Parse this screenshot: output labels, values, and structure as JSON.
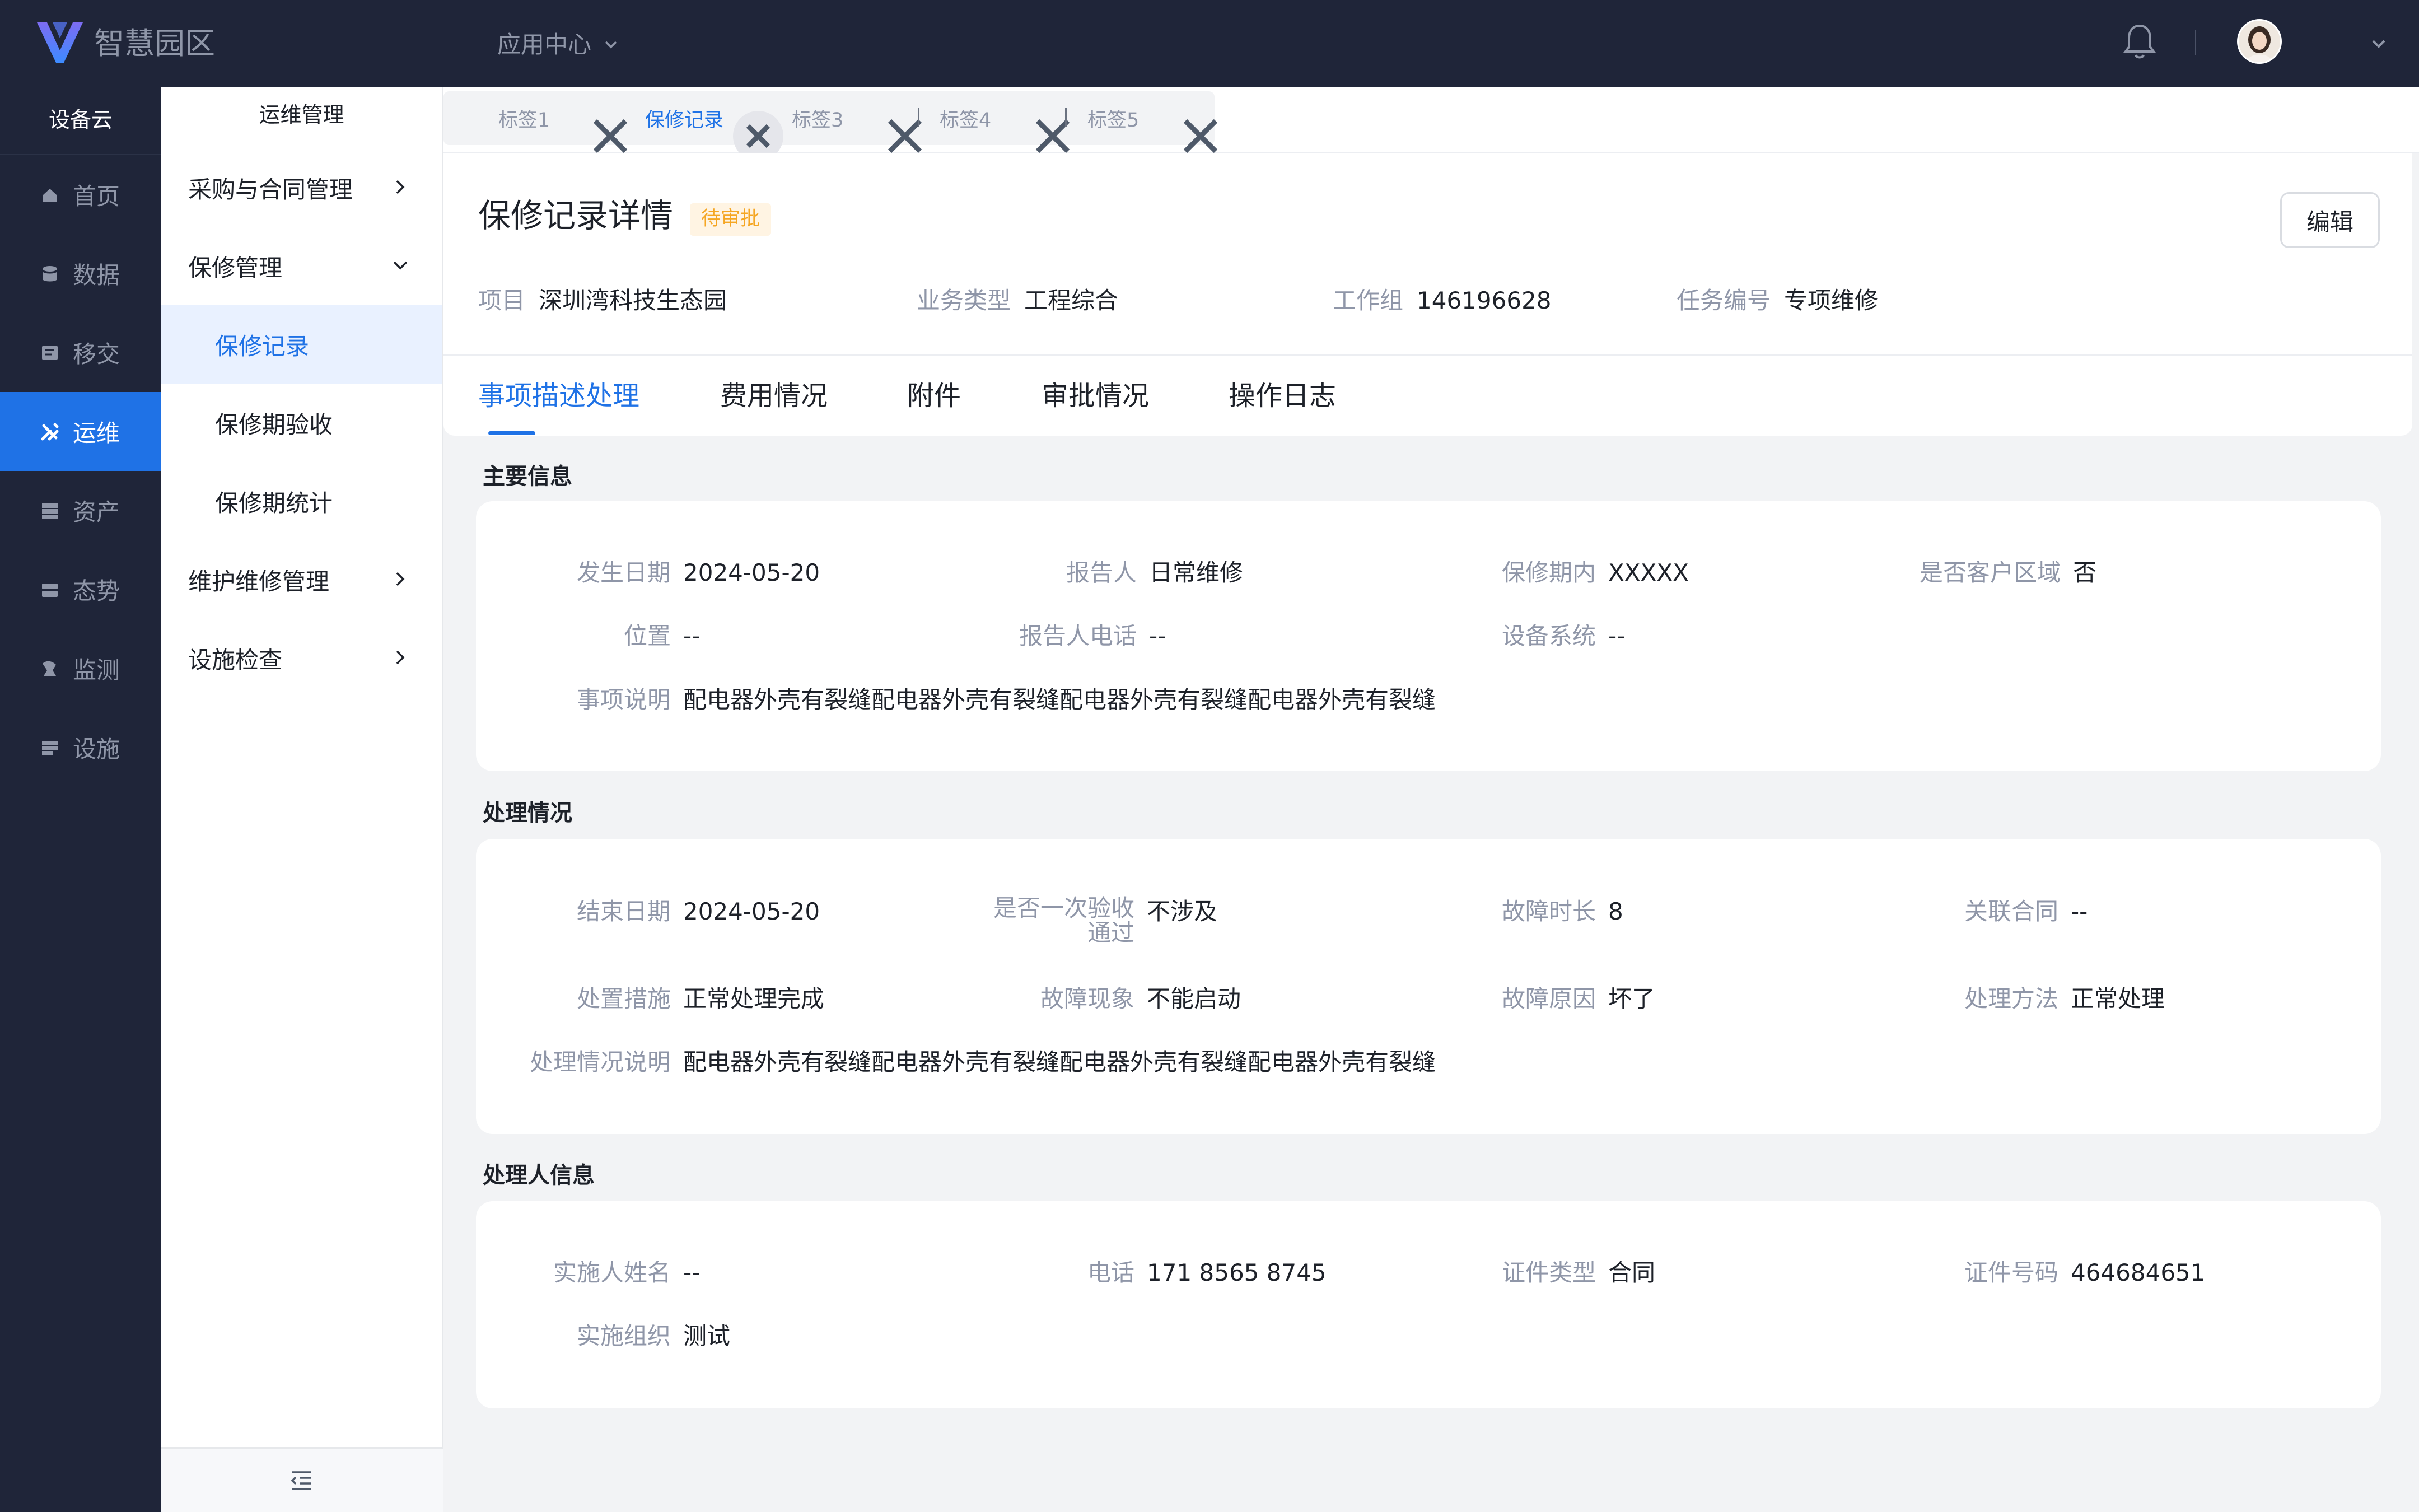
{
  "app": {
    "brand": "智慧园区",
    "app_center": "应用中心"
  },
  "nav": {
    "header": "设备云",
    "items": [
      {
        "label": "首页",
        "icon": "home-icon",
        "active": false
      },
      {
        "label": "数据",
        "icon": "data-icon",
        "active": false
      },
      {
        "label": "移交",
        "icon": "transfer-icon",
        "active": false
      },
      {
        "label": "运维",
        "icon": "tools-icon",
        "active": true
      },
      {
        "label": "资产",
        "icon": "asset-icon",
        "active": false
      },
      {
        "label": "态势",
        "icon": "situation-icon",
        "active": false
      },
      {
        "label": "监测",
        "icon": "monitor-icon",
        "active": false
      },
      {
        "label": "设施",
        "icon": "facility-icon",
        "active": false
      }
    ]
  },
  "submenu": {
    "header": "运维管理",
    "items": [
      {
        "label": "采购与合同管理"
      },
      {
        "label": "保修管理"
      },
      {
        "label": "保修记录"
      },
      {
        "label": "保修期验收"
      },
      {
        "label": "保修期统计"
      },
      {
        "label": "维护维修管理"
      },
      {
        "label": "设施检查"
      }
    ]
  },
  "tags": [
    "标签1",
    "保修记录",
    "标签3",
    "标签4",
    "标签5"
  ],
  "detail": {
    "title": "保修记录详情",
    "status": "待审批",
    "edit": "编辑",
    "meta": [
      {
        "k": "项目",
        "v": "深圳湾科技生态园"
      },
      {
        "k": "业务类型",
        "v": "工程综合"
      },
      {
        "k": "工作组",
        "v": "146196628"
      },
      {
        "k": "任务编号",
        "v": "专项维修"
      }
    ]
  },
  "tabs": [
    "事项描述处理",
    "费用情况",
    "附件",
    "审批情况",
    "操作日志"
  ],
  "main_info": {
    "title": "主要信息",
    "fields": [
      {
        "k": "发生日期",
        "v": "2024-05-20"
      },
      {
        "k": "报告人",
        "v": "日常维修"
      },
      {
        "k": "保修期内",
        "v": "XXXXX"
      },
      {
        "k": "是否客户区域",
        "v": "否"
      },
      {
        "k": "位置",
        "v": "--"
      },
      {
        "k": "报告人电话",
        "v": "--"
      },
      {
        "k": "设备系统",
        "v": "--"
      },
      {
        "k": "事项说明",
        "v": "配电器外壳有裂缝配电器外壳有裂缝配电器外壳有裂缝配电器外壳有裂缝"
      }
    ]
  },
  "process_info": {
    "title": "处理情况",
    "fields": [
      {
        "k": "结束日期",
        "v": "2024-05-20"
      },
      {
        "k": "是否一次验收",
        "k2": "通过",
        "v": "不涉及"
      },
      {
        "k": "故障时长",
        "v": "8"
      },
      {
        "k": "关联合同",
        "v": "--"
      },
      {
        "k": "处置措施",
        "v": "正常处理完成"
      },
      {
        "k": "故障现象",
        "v": "不能启动"
      },
      {
        "k": "故障原因",
        "v": "坏了"
      },
      {
        "k": "处理方法",
        "v": "正常处理"
      },
      {
        "k": "处理情况说明",
        "v": "配电器外壳有裂缝配电器外壳有裂缝配电器外壳有裂缝配电器外壳有裂缝"
      }
    ]
  },
  "handler_info": {
    "title": "处理人信息",
    "fields": [
      {
        "k": "实施人姓名",
        "v": "--"
      },
      {
        "k": "电话",
        "v": "171 8565 8745"
      },
      {
        "k": "证件类型",
        "v": "合同"
      },
      {
        "k": "证件号码",
        "v": "464684651"
      },
      {
        "k": "实施组织",
        "v": "测试"
      }
    ]
  },
  "colors": {
    "primary": "#1f72e6",
    "nav_bg": "#1f2539",
    "badge_bg": "#fff4e3",
    "badge_text": "#f5a623"
  }
}
